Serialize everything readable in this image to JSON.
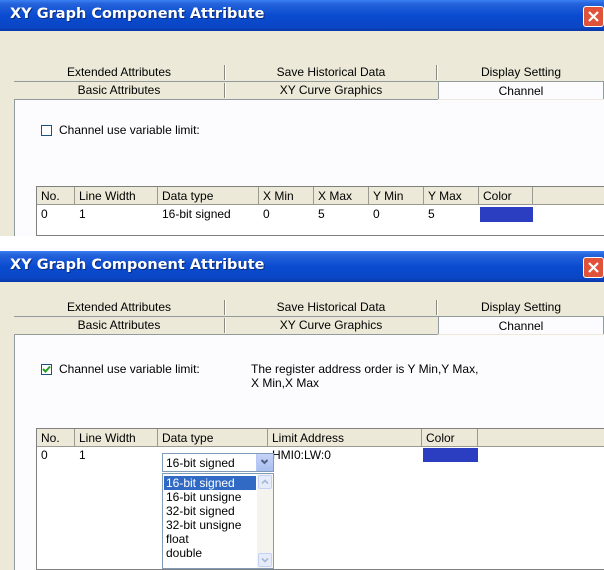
{
  "window_title": "XY Graph Component Attribute",
  "tabs_top": [
    "Extended Attributes",
    "Save Historical Data",
    "Display Setting"
  ],
  "tabs_bottom": [
    "Basic Attributes",
    "XY Curve Graphics",
    "Channel"
  ],
  "checkbox_label": "Channel use variable limit:",
  "panel1": {
    "checked": false,
    "columns": [
      "No.",
      "Line Width",
      "Data type",
      "X Min",
      "X Max",
      "Y Min",
      "Y Max",
      "Color"
    ],
    "row": [
      "0",
      "1",
      "16-bit signed",
      "0",
      "5",
      "0",
      "5"
    ],
    "color": "#2b3ec2"
  },
  "panel2": {
    "checked": true,
    "note_line1": "The register address order is Y Min,Y Max,",
    "note_line2": "X Min,X Max",
    "columns": [
      "No.",
      "Line Width",
      "Data type",
      "Limit Address",
      "Color"
    ],
    "row_no": "0",
    "row_width": "1",
    "combo_value": "16-bit signed",
    "limit_address": "HMI0:LW:0",
    "color": "#2b3ec2",
    "options": [
      "16-bit signed",
      "16-bit unsigne",
      "32-bit signed",
      "32-bit unsigne",
      "float",
      "double"
    ]
  },
  "icons": {
    "close": "close-icon",
    "check": "check-icon",
    "dropdown": "chevron-down-icon"
  }
}
